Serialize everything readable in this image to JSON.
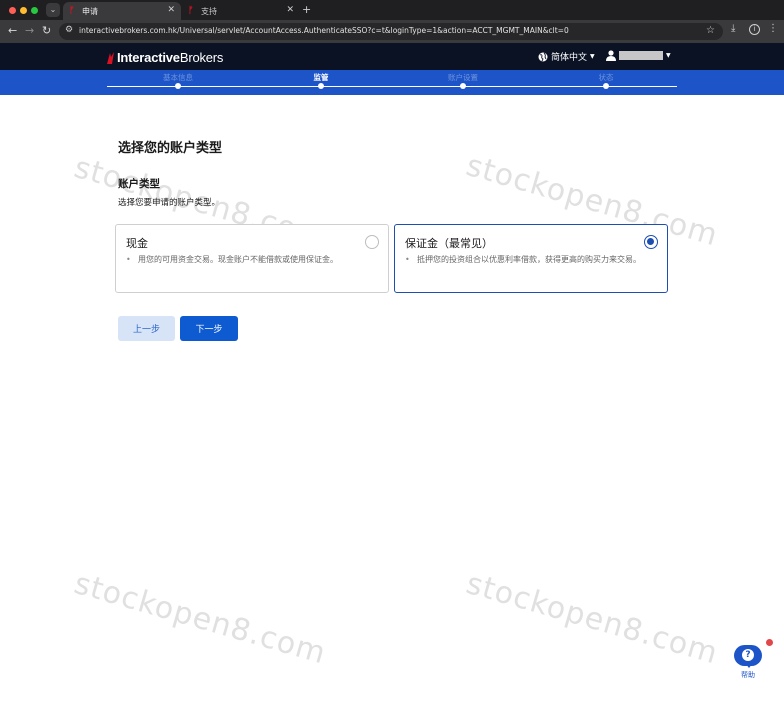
{
  "browser": {
    "tabs": [
      {
        "title": "申请",
        "active": true
      },
      {
        "title": "支持",
        "active": false
      }
    ],
    "url": "interactivebrokers.com.hk/Universal/servlet/AccountAccess.AuthenticateSSO?c=t&loginType=1&action=ACCT_MGMT_MAIN&clt=0"
  },
  "header": {
    "logo_bold": "Interactive",
    "logo_light": "Brokers",
    "language": "简体中文",
    "brand_color": "#d81222"
  },
  "stepper": {
    "steps": [
      {
        "label": "基本信息"
      },
      {
        "label": "监管"
      },
      {
        "label": "账户设置"
      },
      {
        "label": "状态"
      }
    ],
    "active_index": 1
  },
  "main": {
    "page_title": "选择您的账户类型",
    "section_title": "账户类型",
    "section_desc": "选择您要申请的账户类型。",
    "options": [
      {
        "title": "现金",
        "desc": "用您的可用资金交易。现金账户不能借款或使用保证金。",
        "selected": false
      },
      {
        "title": "保证金（最常见）",
        "desc": "抵押您的投资组合以优惠利率借款，获得更高的购买力来交易。",
        "selected": true
      }
    ],
    "prev_label": "上一步",
    "next_label": "下一步"
  },
  "watermark": "stockopen8.com",
  "help": {
    "label": "帮助"
  },
  "colors": {
    "accent": "#1d55c8",
    "primary_button": "#0e5bd1",
    "header_bg": "#0b1224"
  }
}
